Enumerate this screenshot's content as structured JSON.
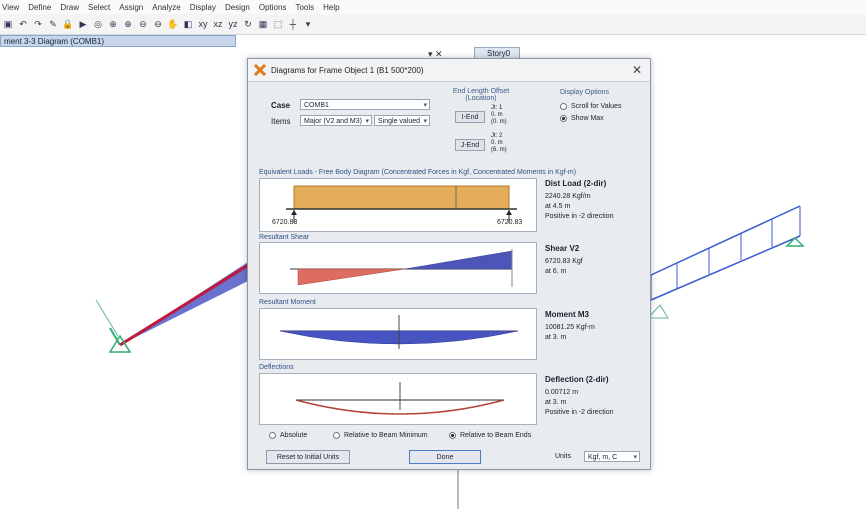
{
  "menu": [
    "View",
    "Define",
    "Draw",
    "Select",
    "Assign",
    "Analyze",
    "Display",
    "Design",
    "Options",
    "Tools",
    "Help"
  ],
  "toolbar": {
    "view_buttons": [
      "xy",
      "xz",
      "yz"
    ]
  },
  "doc_tab": "ment 3-3 Diagram (COMB1)",
  "doc_tab2": "Story0",
  "dialog": {
    "title": "Diagrams for Frame Object 1  (B1 500*200)",
    "case_label": "Case",
    "case_value": "COMB1",
    "items_label": "Items",
    "items_value": "Major (V2 and M3)",
    "items_mode": "Single valued",
    "end_length": {
      "title": "End Length Offset (Location)",
      "iend_label": "I-End",
      "jend_label": "J-End",
      "iend_values": [
        "Jt: 1",
        "0. m",
        "(0. m)"
      ],
      "jend_values": [
        "Jt: 2",
        "0. m",
        "(6. m)"
      ]
    },
    "display_options": {
      "title": "Display Options",
      "scroll_label": "Scroll for Values",
      "showmax_label": "Show Max"
    },
    "equiv_title": "Equivalent Loads - Free Body Diagram  (Concentrated Forces in Kgf, Concentrated Moments in Kgf-m)",
    "equiv_left_value": "6720.83",
    "equiv_right_value": "6720.83",
    "dist_load": {
      "title": "Dist Load (2-dir)",
      "value": "2240.28 Kgf/m",
      "at": "at 4.5 m",
      "dir": "Positive in -2 direction"
    },
    "shear_title": "Resultant Shear",
    "shear": {
      "title": "Shear V2",
      "value": "6720.83 Kgf",
      "at": "at 6. m"
    },
    "moment_title": "Resultant Moment",
    "moment": {
      "title": "Moment M3",
      "value": "10081.25 Kgf-m",
      "at": "at 3. m"
    },
    "defl_title": "Deflections",
    "deflection": {
      "title": "Deflection (2-dir)",
      "value": "0.00712 m",
      "at": "at 3. m",
      "dir": "Positive in -2 direction"
    },
    "radios": [
      "Absolute",
      "Relative to Beam Minimum",
      "Relative to Beam Ends"
    ],
    "reset_label": "Reset to Initial Units",
    "done_label": "Done",
    "units_label": "Units",
    "units_value": "Kgf, m, C"
  },
  "colors": {
    "dist_load": "#e6ad5a",
    "shear_neg": "#dd6d62",
    "shear_pos": "#4c56b8",
    "moment": "#4854c2",
    "deflection": "#b5423a"
  }
}
